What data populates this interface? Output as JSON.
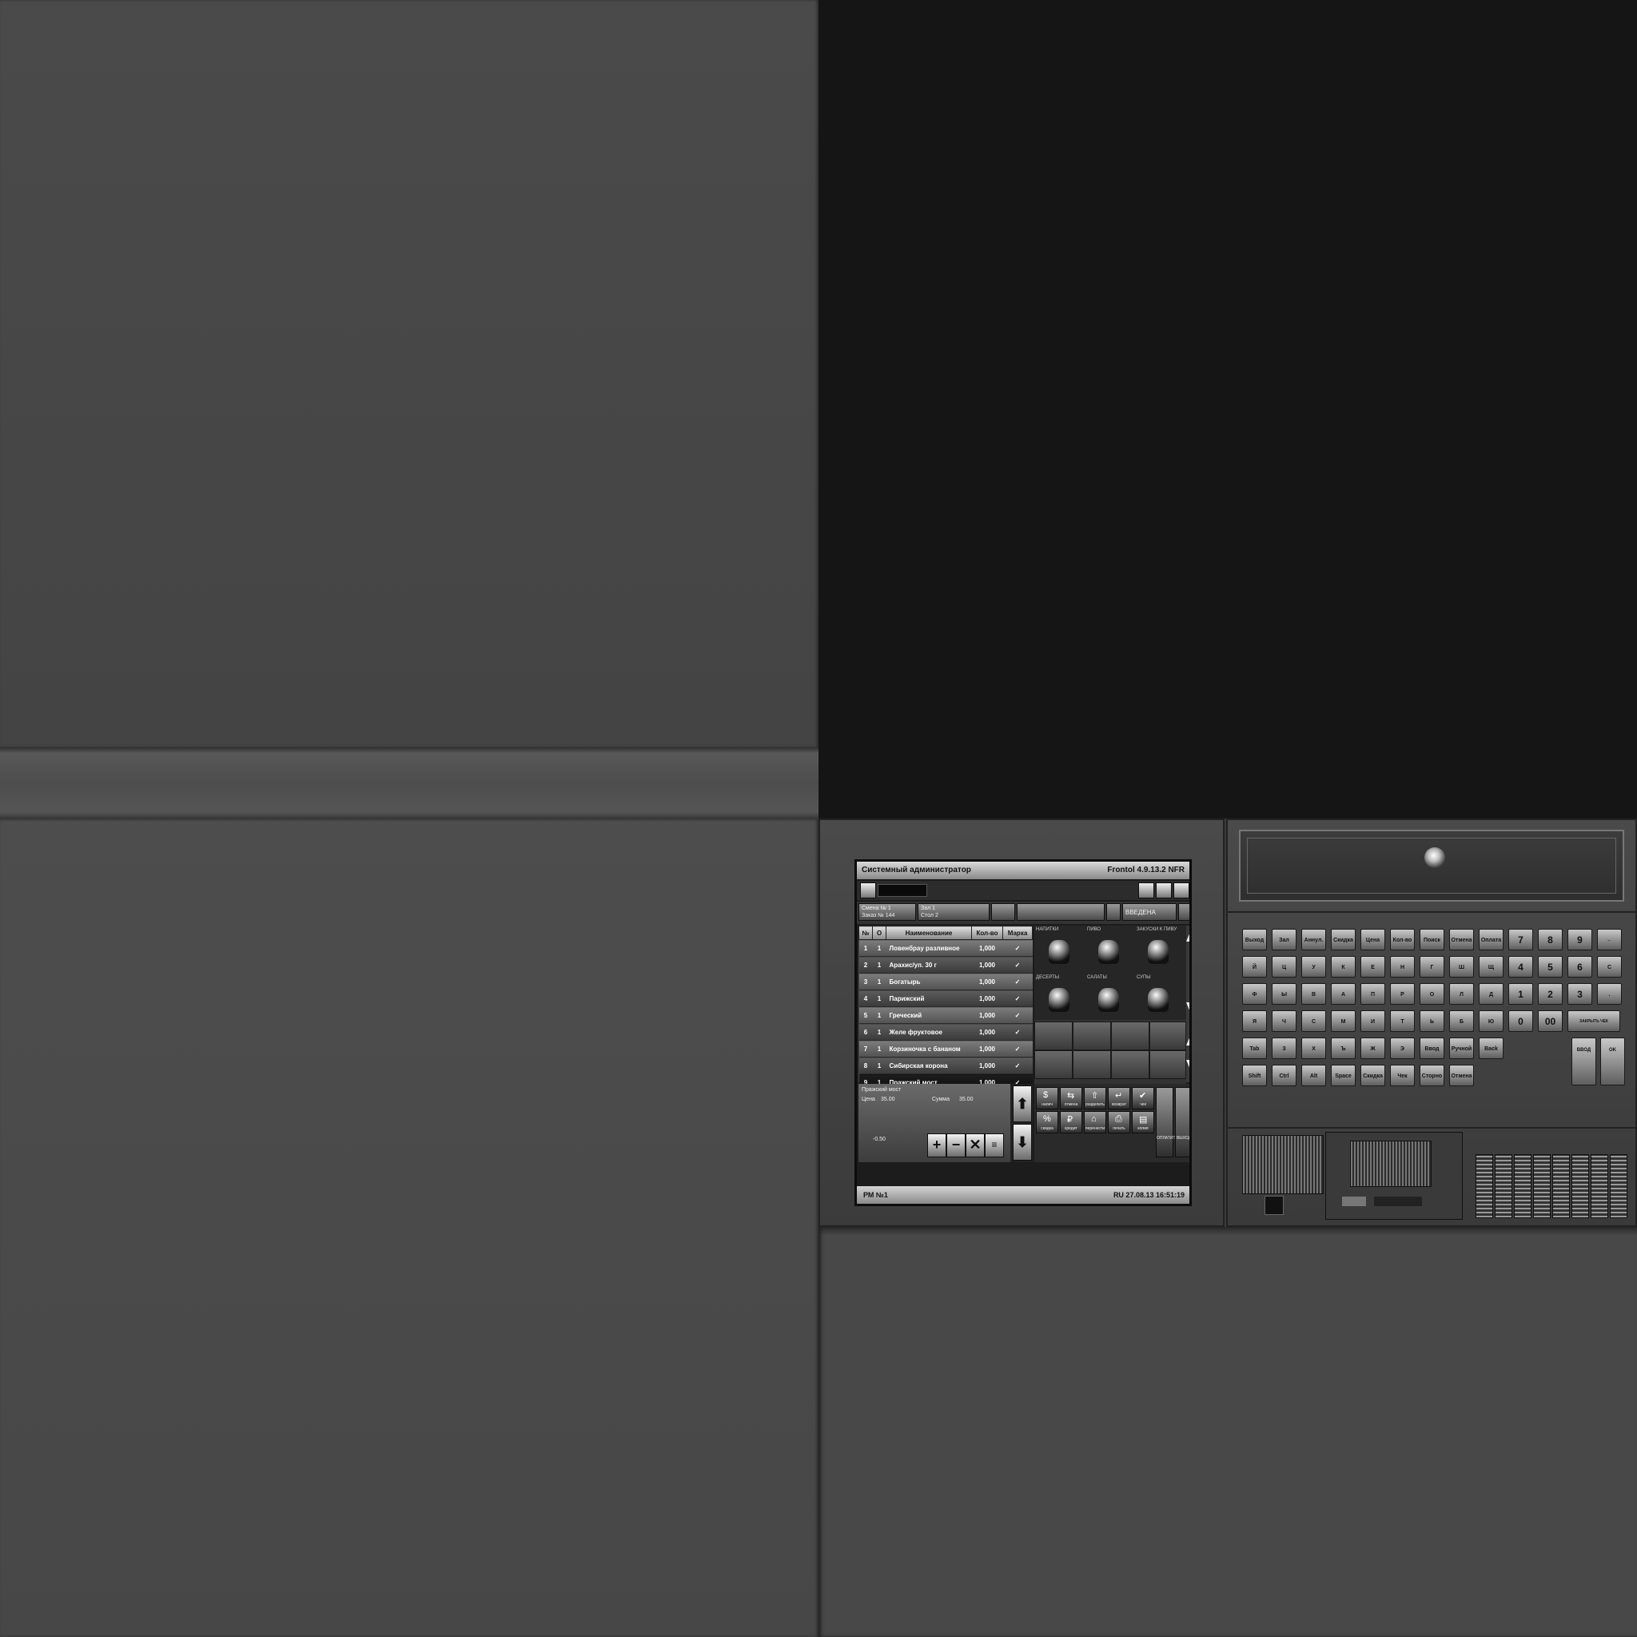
{
  "screen": {
    "title_left": "Системный администратор",
    "title_right": "Frontol 4.9.13.2 NFR",
    "info": {
      "shift": "Смена № 1",
      "order": "Заказ № 144",
      "hall": "Зал 1",
      "table": "Стол 2",
      "state": "ВВЕДЕНА"
    },
    "receipt": {
      "headers": [
        "№",
        "О",
        "Наименование",
        "Кол-во",
        "Марка"
      ],
      "rows": [
        {
          "n": "1",
          "o": "1",
          "name": "Ловенбрау разливное",
          "qty": "1,000",
          "mark": "✓"
        },
        {
          "n": "2",
          "o": "1",
          "name": "Арахис/уп. 30 г",
          "qty": "1,000",
          "mark": "✓"
        },
        {
          "n": "3",
          "o": "1",
          "name": "Богатырь",
          "qty": "1,000",
          "mark": "✓"
        },
        {
          "n": "4",
          "o": "1",
          "name": "Парижский",
          "qty": "1,000",
          "mark": "✓"
        },
        {
          "n": "5",
          "o": "1",
          "name": "Греческий",
          "qty": "1,000",
          "mark": "✓"
        },
        {
          "n": "6",
          "o": "1",
          "name": "Желе фруктовое",
          "qty": "1,000",
          "mark": "✓"
        },
        {
          "n": "7",
          "o": "1",
          "name": "Корзиночка с бананом",
          "qty": "1,000",
          "mark": "✓"
        },
        {
          "n": "8",
          "o": "1",
          "name": "Сибирская корона",
          "qty": "1,000",
          "mark": "✓"
        },
        {
          "n": "9",
          "o": "1",
          "name": "Пражский мост",
          "qty": "1,000",
          "mark": "✓"
        }
      ]
    },
    "menu_categories": [
      "НАПИТКИ",
      "ПИВО",
      "ЗАКУСКИ К ПИВУ",
      "ДЕСЕРТЫ",
      "САЛАТЫ",
      "СУПЫ"
    ],
    "detail": {
      "item": "Пражский мост",
      "price_label": "Цена",
      "price": "35.00",
      "sum_label": "Сумма",
      "sum": "35.00",
      "discount": "-0.50"
    },
    "functions": [
      "+",
      "−",
      "✕",
      "≡"
    ],
    "func_buttons": [
      {
        "glyph": "$",
        "label": "налич"
      },
      {
        "glyph": "⇆",
        "label": "отмена"
      },
      {
        "glyph": "⇧",
        "label": "разделить"
      },
      {
        "glyph": "↵",
        "label": "возврат"
      },
      {
        "glyph": "✔",
        "label": "чек"
      },
      {
        "glyph": "%",
        "label": "скидка"
      },
      {
        "glyph": "₽",
        "label": "кредит"
      },
      {
        "glyph": "⌂",
        "label": "перенести"
      },
      {
        "glyph": "⎙",
        "label": "печать"
      },
      {
        "glyph": "▤",
        "label": "копия"
      }
    ],
    "pay_label": "ОПЛАТИТЬ",
    "exit_label": "ВЫХОД",
    "status_left": "РМ №1",
    "status_right": "RU 27.08.13  16:51:19"
  },
  "keyboard": {
    "row1": [
      "Выход",
      "Зал",
      "Аннул.",
      "Скидка",
      "Цена",
      "Кол-во",
      "Поиск",
      "Отмена",
      "Оплата",
      "7",
      "8",
      "9",
      "←"
    ],
    "row2": [
      "Й",
      "Ц",
      "У",
      "К",
      "Е",
      "Н",
      "Г",
      "Ш",
      "Щ",
      "4",
      "5",
      "6",
      "С"
    ],
    "row3": [
      "Ф",
      "Ы",
      "В",
      "А",
      "П",
      "Р",
      "О",
      "Л",
      "Д",
      "1",
      "2",
      "3",
      "."
    ],
    "row4": [
      "Я",
      "Ч",
      "С",
      "М",
      "И",
      "Т",
      "Ь",
      "Б",
      "Ю",
      "0",
      "00",
      "ЗАКРЫТЬ ЧЕК"
    ],
    "row5": [
      "Tab",
      "З",
      "Х",
      "Ъ",
      "Ж",
      "Э",
      "Ввод",
      "Ручной",
      "Back Space"
    ],
    "row6": [
      "Shift",
      "Ctrl",
      "Alt",
      "Space",
      "Скидка",
      "Чек",
      "Сторно",
      "Отмена чека"
    ],
    "right_tall": [
      "ВВОД",
      "OK"
    ]
  }
}
